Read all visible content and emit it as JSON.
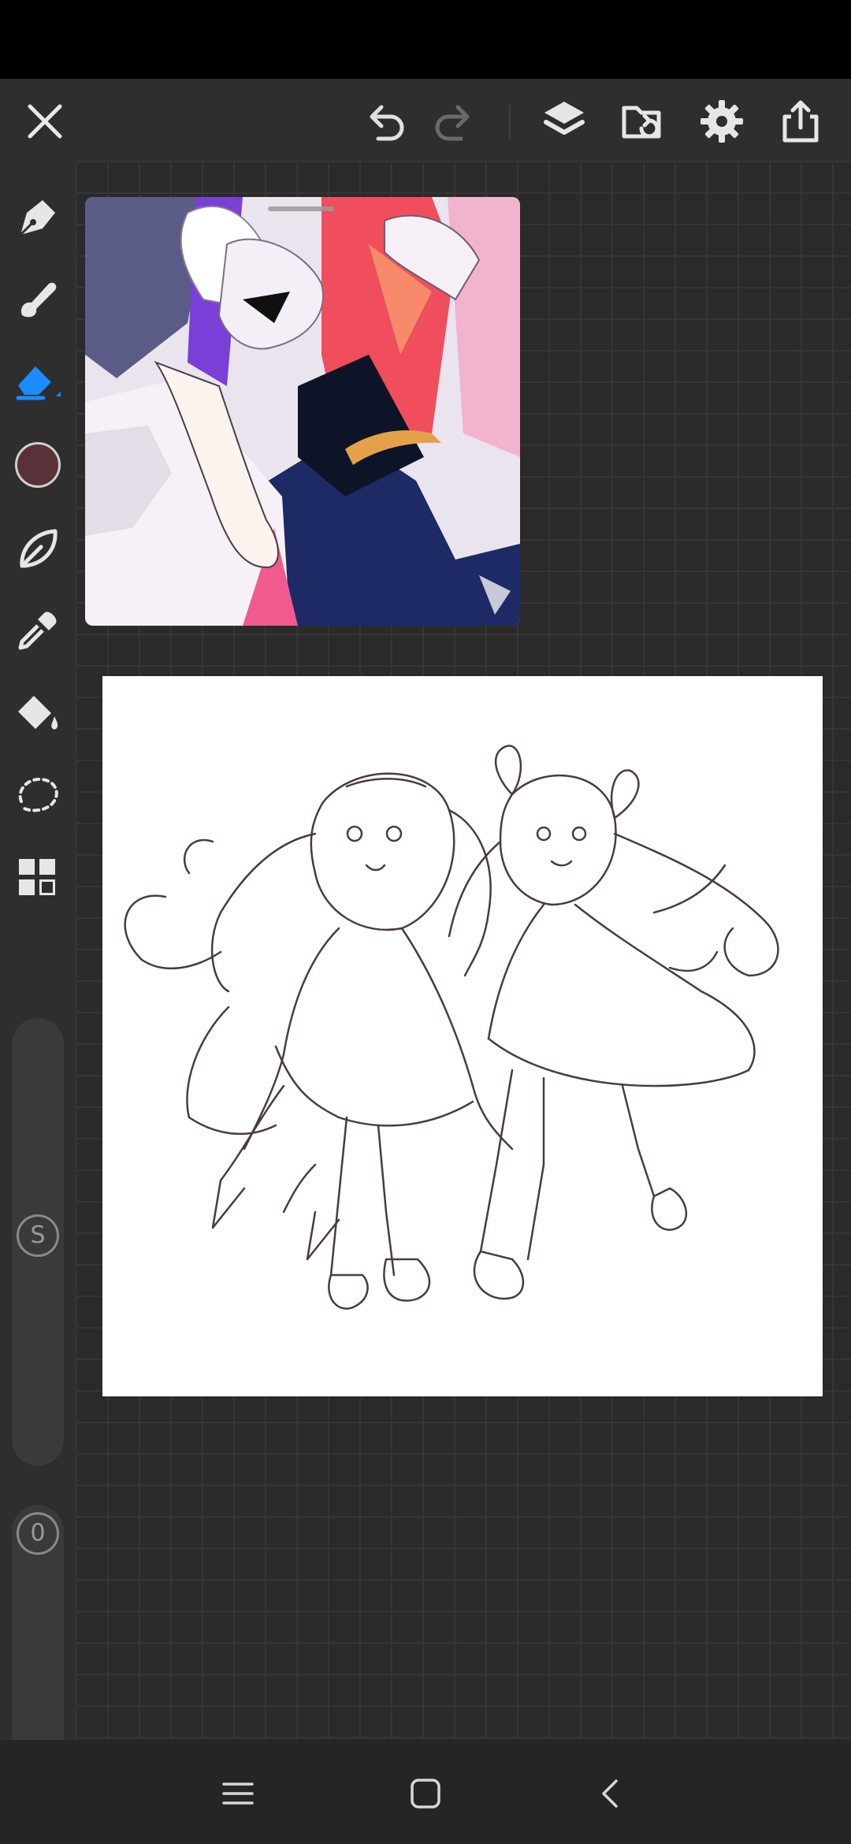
{
  "app": {
    "accent_color": "#1a8cff",
    "active_tool": "eraser",
    "brush_color": "#5a3138"
  },
  "toolbar": {
    "icons": [
      "close-icon",
      "undo-icon",
      "redo-icon",
      "layers-icon",
      "import-icon",
      "gear-icon",
      "share-icon"
    ]
  },
  "tools": [
    "pen-icon",
    "brush-icon",
    "eraser-icon",
    "color-swatch",
    "smudge-icon",
    "eyedropper-icon",
    "fill-bucket-icon",
    "lasso-icon",
    "grid-icon"
  ],
  "sliders": {
    "size_label": "S",
    "opacity_label": "0"
  },
  "navigation": {
    "icons": [
      "menu-icon",
      "home-icon",
      "back-icon"
    ]
  }
}
